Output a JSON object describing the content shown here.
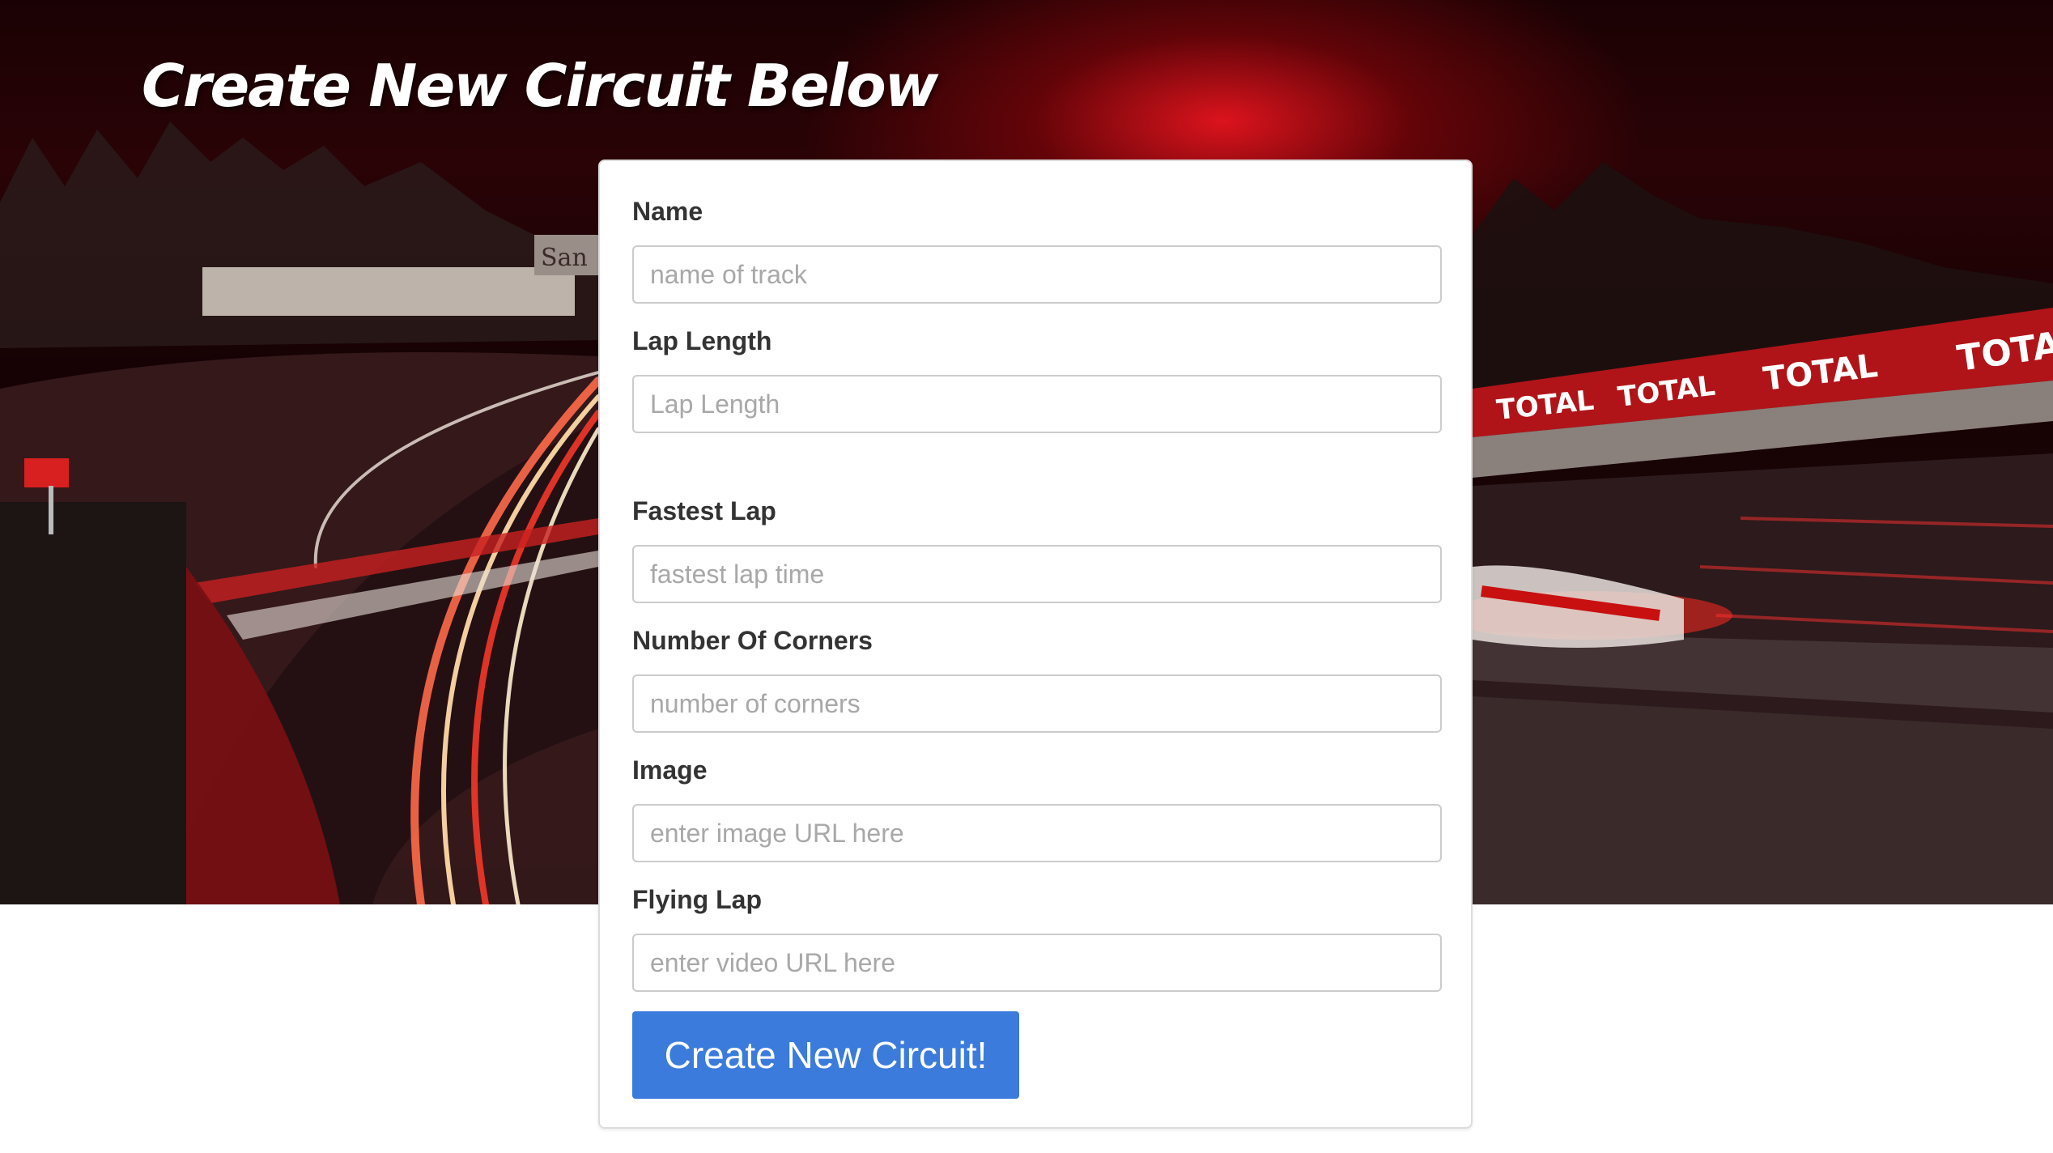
{
  "header": {
    "title": "Create New Circuit Below"
  },
  "form": {
    "fields": [
      {
        "label": "Name",
        "placeholder": "name of track",
        "value": ""
      },
      {
        "label": "Lap Length",
        "placeholder": "Lap Length",
        "value": ""
      },
      {
        "label": "Fastest Lap",
        "placeholder": "fastest lap time",
        "value": ""
      },
      {
        "label": "Number Of Corners",
        "placeholder": "number of corners",
        "value": ""
      },
      {
        "label": "Image",
        "placeholder": "enter image URL here",
        "value": ""
      },
      {
        "label": "Flying Lap",
        "placeholder": "enter video URL here",
        "value": ""
      }
    ],
    "submit_label": "Create New Circuit!"
  },
  "hero": {
    "banner_text": "TOTAL",
    "sign_text": "San"
  },
  "colors": {
    "accent": "#3a7bdc",
    "hero_red": "#c8101a",
    "label_text": "#333333",
    "placeholder_text": "#a8a8a8"
  }
}
